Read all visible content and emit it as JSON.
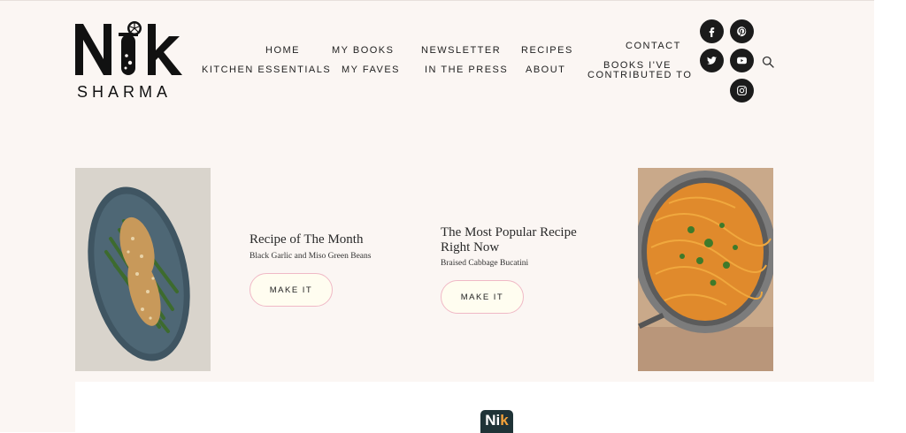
{
  "logo": {
    "main": "Nik",
    "sub": "SHARMA"
  },
  "nav": {
    "home": "HOME",
    "my_books": "MY BOOKS",
    "newsletter": "NEWSLETTER",
    "recipes": "RECIPES",
    "contact": "CONTACT",
    "kitchen_essentials": "KITCHEN ESSENTIALS",
    "my_faves": "MY FAVES",
    "in_the_press": "IN THE PRESS",
    "about": "ABOUT",
    "books_contributed_line1": "BOOKS I'VE",
    "books_contributed_line2": "CONTRIBUTED TO"
  },
  "social": [
    "facebook-icon",
    "pinterest-icon",
    "twitter-icon",
    "youtube-icon",
    "instagram-icon"
  ],
  "cards": {
    "recipe_of_month": {
      "title": "Recipe of The Month",
      "subtitle": "Black Garlic and Miso Green Beans",
      "button": "MAKE IT"
    },
    "most_popular": {
      "title_line1": "The Most Popular Recipe",
      "title_line2": "Right Now",
      "subtitle": "Braised Cabbage Bucatini",
      "button": "MAKE IT"
    }
  },
  "footer": {
    "logo_text_a": "Ni",
    "logo_text_b": "k"
  },
  "colors": {
    "background": "#fbf6f3",
    "button_border": "#f0b9c6",
    "button_fill": "#fffdf0",
    "icon_bg": "#1b1b1b"
  }
}
